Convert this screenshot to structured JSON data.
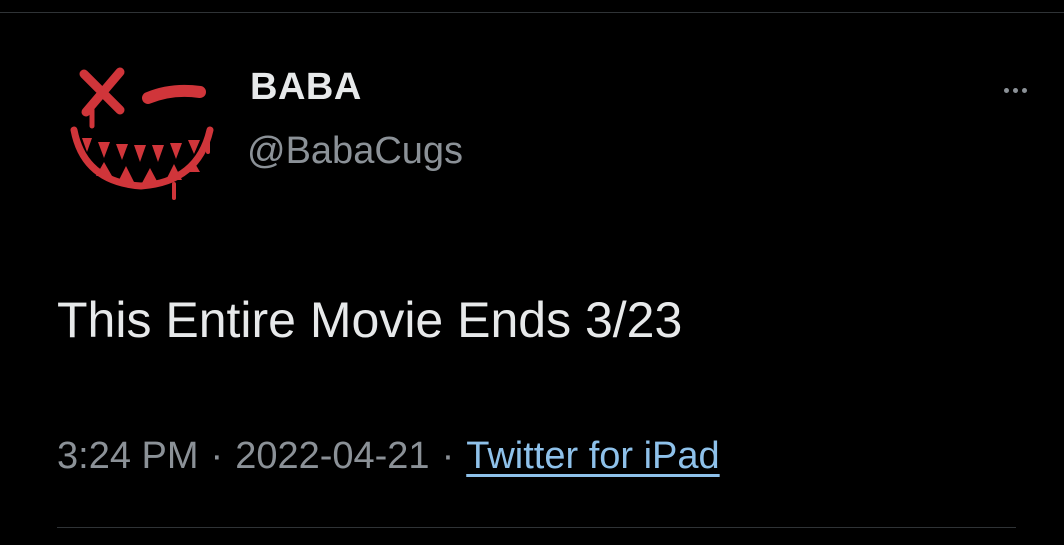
{
  "tweet": {
    "author": {
      "display_name": "BABA",
      "handle": "@BabaCugs",
      "avatar_icon": "grinning-x-eye-face-icon",
      "avatar_color": "#d0353a"
    },
    "more_icon": "more-options-icon",
    "text": "This Entire Movie Ends 3/23",
    "meta": {
      "time": "3:24 PM",
      "separator": "·",
      "date": "2022-04-21",
      "source": "Twitter for iPad"
    }
  },
  "colors": {
    "background": "#000000",
    "primary_text": "#e7e9ea",
    "secondary_text": "#8b9197",
    "link": "#8ec1ea"
  }
}
